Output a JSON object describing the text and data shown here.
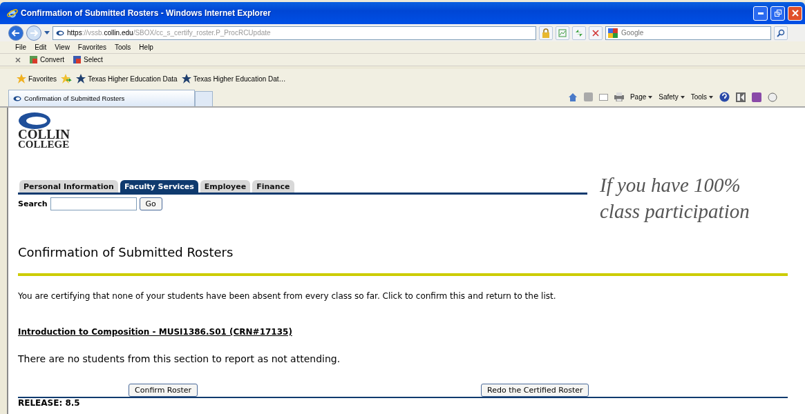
{
  "window": {
    "title": "Confirmation of Submitted Rosters - Windows Internet Explorer"
  },
  "address_bar": {
    "url_parts": [
      {
        "text": "https",
        "dim": false
      },
      {
        "text": "://vssb.",
        "dim": true
      },
      {
        "text": "collin.edu",
        "dim": false
      },
      {
        "text": "/SBOX/cc_s_certify_roster.P_ProcRCUpdate",
        "dim": true
      }
    ]
  },
  "search_box": {
    "placeholder": "Google"
  },
  "menu": [
    "File",
    "Edit",
    "View",
    "Favorites",
    "Tools",
    "Help"
  ],
  "toolbar": [
    "Convert",
    "Select"
  ],
  "favorites_bar": {
    "label": "Favorites",
    "links": [
      "Texas Higher Education Data",
      "Texas Higher Education Dat…"
    ]
  },
  "browser_tabs": [
    {
      "title": "Confirmation of Submitted Rosters",
      "selected": true
    }
  ],
  "command_bar": [
    "Page",
    "Safety",
    "Tools"
  ],
  "page": {
    "logo": [
      "COLLIN",
      "COLLEGE"
    ],
    "tabs": [
      {
        "label": "Personal Information",
        "selected": false
      },
      {
        "label": "Faculty Services",
        "selected": true
      },
      {
        "label": "Employee",
        "selected": false
      },
      {
        "label": "Finance",
        "selected": false
      }
    ],
    "search_label": "Search",
    "search_button": "Go",
    "annotation": "If you have 100% class participation",
    "heading": "Confirmation of Submitted Rosters",
    "instruction": "You are certifying that none of your students have been absent from every class so far. Click to confirm this and return to the list.",
    "course_link": "Introduction to Composition - MUSI1386.S01 (CRN#17135)",
    "message": "There are no students from this section to report as not attending.",
    "buttons": [
      "Confirm Roster",
      "Redo the Certified Roster"
    ],
    "release": "RELEASE: 8.5"
  }
}
